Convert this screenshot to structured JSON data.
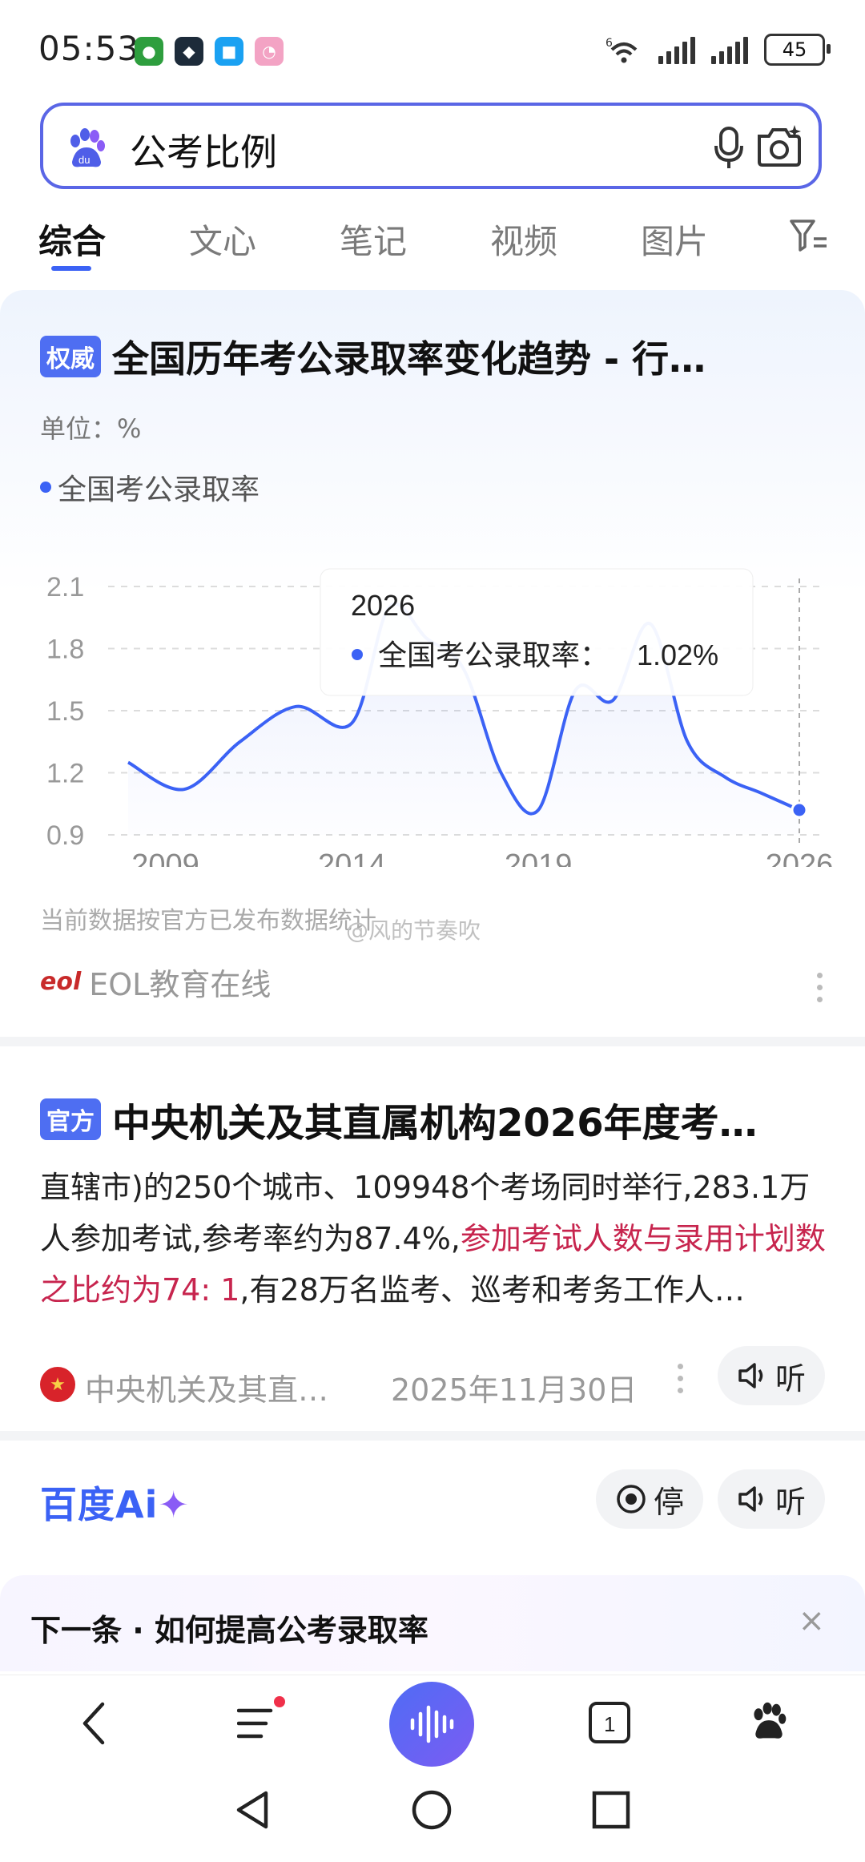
{
  "status_bar": {
    "time": "05:53",
    "battery": "45",
    "network": "6"
  },
  "search": {
    "query": "公考比例"
  },
  "tabs": [
    {
      "label": "综合",
      "active": true
    },
    {
      "label": "文心"
    },
    {
      "label": "笔记"
    },
    {
      "label": "视频"
    },
    {
      "label": "图片"
    }
  ],
  "card1": {
    "badge": "权威",
    "title": "全国历年考公录取率变化趋势 - 行…",
    "unit": "单位：%",
    "legend": "全国考公录取率",
    "tooltip": {
      "year": "2026",
      "label": "全国考公录取率：",
      "value": "1.02%"
    },
    "note": "当前数据按官方已发布数据统计",
    "watermark": "@风的节奏吹",
    "source": "EOL教育在线",
    "source_logo": "eol"
  },
  "chart_data": {
    "type": "line",
    "series": [
      {
        "name": "全国考公录取率",
        "x": [
          2008,
          2009.5,
          2011,
          2012.5,
          2014,
          2015,
          2016,
          2017,
          2018,
          2019,
          2020,
          2021,
          2022,
          2023,
          2024,
          2025,
          2026
        ],
        "values": [
          1.25,
          1.12,
          1.35,
          1.52,
          1.44,
          2.0,
          1.85,
          1.7,
          1.2,
          1.02,
          1.6,
          1.55,
          1.92,
          1.35,
          1.18,
          1.1,
          1.02
        ]
      }
    ],
    "xticks": [
      "2009",
      "2014",
      "2019",
      "2026"
    ],
    "yticks": [
      "0.9",
      "1.2",
      "1.5",
      "1.8",
      "2.1"
    ],
    "ylim": [
      0.9,
      2.1
    ],
    "xlim": [
      2008,
      2026
    ],
    "grid": true,
    "accent": "#3b62f5"
  },
  "card2": {
    "badge": "官方",
    "title": "中央机关及其直属机构2026年度考…",
    "body_1": "直辖市)的250个城市、109948个考场同时举行,283.1万人参加考试,参考率约为87.4%,",
    "body_highlight": "参加考试人数与录用计划数之比约为74: 1",
    "body_2": ",有28万名监考、巡考和考务工作人…",
    "source": "中央机关及其直…",
    "date": "2025年11月30日",
    "listen_label": "听"
  },
  "card3": {
    "brand": "百度Ai",
    "brand_plus": "✦",
    "stop_label": "停",
    "listen_label": "听"
  },
  "next": {
    "text": "下一条 · 如何提高公考录取率",
    "close": "×"
  },
  "bottom_nav": {
    "tab_count": "1"
  }
}
